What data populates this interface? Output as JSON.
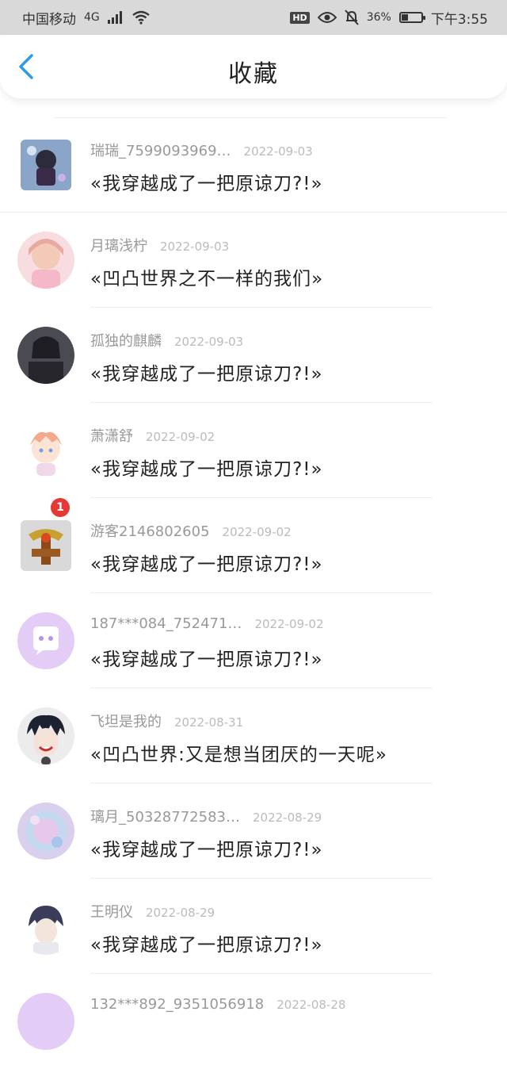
{
  "status_bar": {
    "carrier": "中国移动",
    "network": "4G",
    "battery": "36%",
    "battery_level": 0.36,
    "time": "下午3:55"
  },
  "header": {
    "title": "收藏"
  },
  "items": [
    {
      "name": "瑞瑞_7599093969…",
      "date": "2022-09-03",
      "book": "«我穿越成了一把原谅刀?!»"
    },
    {
      "name": "月璃浅柠",
      "date": "2022-09-03",
      "book": "«凹凸世界之不一样的我们»"
    },
    {
      "name": "孤独的麒麟",
      "date": "2022-09-03",
      "book": "«我穿越成了一把原谅刀?!»"
    },
    {
      "name": "萧潇舒",
      "date": "2022-09-02",
      "book": "«我穿越成了一把原谅刀?!»"
    },
    {
      "name": "游客2146802605",
      "date": "2022-09-02",
      "book": "«我穿越成了一把原谅刀?!»",
      "badge": "1"
    },
    {
      "name": "187***084_752471…",
      "date": "2022-09-02",
      "book": "«我穿越成了一把原谅刀?!»"
    },
    {
      "name": "飞坦是我的",
      "date": "2022-08-31",
      "book": "«凹凸世界:又是想当团厌的一天呢»"
    },
    {
      "name": "璃月_50328772583…",
      "date": "2022-08-29",
      "book": "«我穿越成了一把原谅刀?!»"
    },
    {
      "name": "王明仪",
      "date": "2022-08-29",
      "book": "«我穿越成了一把原谅刀?!»"
    },
    {
      "name": "132***892_9351056918",
      "date": "2022-08-28",
      "book": ""
    }
  ],
  "colors": {
    "accent": "#2f9be8",
    "badge": "#e53935",
    "default_avatar": "#e3cdf6"
  }
}
